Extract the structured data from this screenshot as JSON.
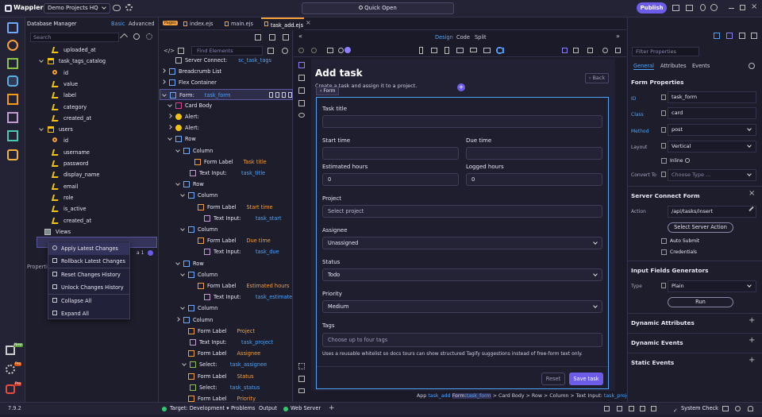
{
  "app": {
    "logo_text": "Wappler",
    "project": "Demo Projects HQ",
    "quick_open": "Quick Open",
    "publish": "Publish",
    "version": "7.9.2"
  },
  "db_panel": {
    "title": "Database Manager",
    "mode_basic": "Basic",
    "mode_advanced": "Advanced",
    "search_placeholder": "Search",
    "rows": [
      {
        "label": "uploaded_at",
        "kind": "field"
      },
      {
        "label": "task_tags_catalog",
        "kind": "table"
      },
      {
        "label": "id",
        "kind": "key"
      },
      {
        "label": "value",
        "kind": "field"
      },
      {
        "label": "label",
        "kind": "field"
      },
      {
        "label": "category",
        "kind": "field"
      },
      {
        "label": "created_at",
        "kind": "field"
      },
      {
        "label": "users",
        "kind": "table"
      },
      {
        "label": "id",
        "kind": "key"
      },
      {
        "label": "username",
        "kind": "field"
      },
      {
        "label": "password",
        "kind": "field"
      },
      {
        "label": "display_name",
        "kind": "field"
      },
      {
        "label": "email",
        "kind": "field"
      },
      {
        "label": "role",
        "kind": "field"
      },
      {
        "label": "is_active",
        "kind": "field"
      },
      {
        "label": "created_at",
        "kind": "field"
      },
      {
        "label": "Views",
        "kind": "folder"
      }
    ],
    "badge_count": "a 1",
    "properties_label": "Properties"
  },
  "context_menu": {
    "items": [
      "Apply Latest Changes",
      "Rollback Latest Changes",
      "Reset Changes History",
      "Unlock Changes History",
      "Collapse All",
      "Expand All"
    ]
  },
  "tabs": {
    "pages_badge": "Pages",
    "items": [
      "index.ejs",
      "main.ejs",
      "task_add.ejs"
    ]
  },
  "structure": {
    "find_placeholder": "Find Elements",
    "rows": [
      {
        "name": "Server Connect:",
        "id": "sc_task_tags",
        "icon": "server-icon"
      },
      {
        "name": "Breadcrumb List",
        "id": "",
        "icon": "breadcrumb-icon"
      },
      {
        "name": "Flex Container",
        "id": "",
        "icon": "flex-icon"
      },
      {
        "name": "Form:",
        "id": "task_form",
        "icon": "form-icon"
      },
      {
        "name": "Card Body",
        "id": "",
        "icon": "card-icon"
      },
      {
        "name": "Alert:",
        "id": "",
        "icon": "alert-icon"
      },
      {
        "name": "Alert:",
        "id": "",
        "icon": "alert-icon"
      },
      {
        "name": "Row",
        "id": "",
        "icon": "row-icon"
      },
      {
        "name": "Column",
        "id": "",
        "icon": "column-icon"
      },
      {
        "name": "Form Label",
        "id": "Task title",
        "icon": "label-icon"
      },
      {
        "name": "Text Input:",
        "id": "task_title",
        "icon": "input-icon"
      },
      {
        "name": "Row",
        "id": "",
        "icon": "row-icon"
      },
      {
        "name": "Column",
        "id": "",
        "icon": "column-icon"
      },
      {
        "name": "Form Label",
        "id": "Start time",
        "icon": "label-icon"
      },
      {
        "name": "Text Input:",
        "id": "task_start",
        "icon": "input-icon"
      },
      {
        "name": "Column",
        "id": "",
        "icon": "column-icon"
      },
      {
        "name": "Form Label",
        "id": "Due time",
        "icon": "label-icon"
      },
      {
        "name": "Text Input:",
        "id": "task_due",
        "icon": "input-icon"
      },
      {
        "name": "Row",
        "id": "",
        "icon": "row-icon"
      },
      {
        "name": "Column",
        "id": "",
        "icon": "column-icon"
      },
      {
        "name": "Form Label",
        "id": "Estimated hours",
        "icon": "label-icon"
      },
      {
        "name": "Text Input:",
        "id": "task_estimate",
        "icon": "input-icon"
      },
      {
        "name": "Column",
        "id": "",
        "icon": "column-icon"
      },
      {
        "name": "Column",
        "id": "",
        "icon": "column-icon"
      },
      {
        "name": "Form Label",
        "id": "Project",
        "icon": "label-icon"
      },
      {
        "name": "Text Input:",
        "id": "task_project",
        "icon": "input-icon"
      },
      {
        "name": "Form Label",
        "id": "Assignee",
        "icon": "label-icon"
      },
      {
        "name": "Select:",
        "id": "task_assignee",
        "icon": "select-icon"
      },
      {
        "name": "Form Label",
        "id": "Status",
        "icon": "label-icon"
      },
      {
        "name": "Select:",
        "id": "task_status",
        "icon": "select-icon"
      },
      {
        "name": "Form Label",
        "id": "Priority",
        "icon": "label-icon"
      }
    ]
  },
  "design": {
    "mode_design": "Design",
    "mode_code": "Code",
    "mode_split": "Split",
    "page_title": "Add task",
    "page_subtitle": "Create a task and assign it to a project.",
    "back_label": "Back",
    "form_chip": "Form",
    "fields": {
      "task_title": {
        "label": "Task title",
        "value": ""
      },
      "start": {
        "label": "Start time",
        "value": ""
      },
      "due": {
        "label": "Due time",
        "value": ""
      },
      "estimated": {
        "label": "Estimated hours",
        "value": "0"
      },
      "logged": {
        "label": "Logged hours",
        "value": "0"
      },
      "project": {
        "label": "Project",
        "placeholder": "Select project"
      },
      "assignee": {
        "label": "Assignee",
        "value": "Unassigned"
      },
      "status": {
        "label": "Status",
        "value": "Todo"
      },
      "priority": {
        "label": "Priority",
        "value": "Medium"
      },
      "tags": {
        "label": "Tags",
        "placeholder": "Choose up to four tags",
        "help": "Uses a reusable whitelist so docs tours can show structured Tagify suggestions instead of free-form text only."
      }
    },
    "reset_label": "Reset",
    "save_label": "Save task"
  },
  "breadcrumb_path": {
    "app": "App",
    "app_id": "task_add",
    "form": "Form:",
    "form_id": "task_form",
    "rest": "> Card Body > Row > Column > Text Input:",
    "input_id": "task_project"
  },
  "props": {
    "filter_placeholder": "Filter Properties",
    "tab_general": "General",
    "tab_attributes": "Attributes",
    "tab_events": "Events",
    "form_props_title": "Form Properties",
    "id_label": "ID",
    "id_value": "task_form",
    "class_label": "Class",
    "class_value": "card",
    "method_label": "Method",
    "method_value": "post",
    "layout_label": "Layout",
    "layout_value": "Vertical",
    "inline_label": "Inline",
    "convert_label": "Convert To",
    "convert_placeholder": "Choose Type ...",
    "sc_form_title": "Server Connect Form",
    "action_label": "Action",
    "action_value": "/api/tasks/insert",
    "select_action_button": "Select Server Action",
    "auto_submit_label": "Auto Submit",
    "credentials_label": "Credentials",
    "generators_title": "Input Fields Generators",
    "type_label": "Type",
    "type_value": "Plain",
    "run_label": "Run",
    "dyn_attributes": "Dynamic Attributes",
    "dyn_events": "Dynamic Events",
    "static_events": "Static Events"
  },
  "status_bar": {
    "target_label": "Target: Development",
    "problems": "Problems",
    "output": "Output",
    "web_server": "Web Server",
    "system_check": "System Check"
  },
  "sidebar_badges": {
    "new": "New",
    "pro": "Pro"
  },
  "colors": {
    "accent_purple": "#6c5ce7",
    "orange": "#f6a03c",
    "blue": "#4fa3f7",
    "green": "#2ecc71"
  }
}
